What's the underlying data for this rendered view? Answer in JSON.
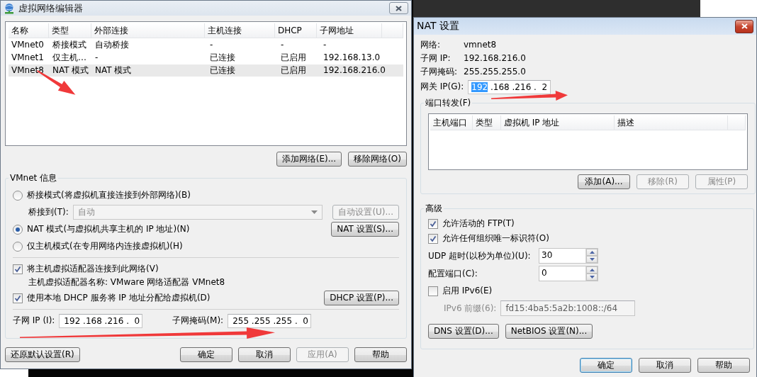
{
  "network_editor": {
    "title": "虚拟网络编辑器",
    "table": {
      "columns": [
        "名称",
        "类型",
        "外部连接",
        "主机连接",
        "DHCP",
        "子网地址"
      ],
      "rows": [
        {
          "cells": [
            "VMnet0",
            "桥接模式",
            "自动桥接",
            "-",
            "-",
            "-"
          ],
          "selected": false
        },
        {
          "cells": [
            "VMnet1",
            "仅主机…",
            "-",
            "已连接",
            "已启用",
            "192.168.13.0"
          ],
          "selected": false
        },
        {
          "cells": [
            "VMnet8",
            "NAT 模式",
            "NAT 模式",
            "已连接",
            "已启用",
            "192.168.216.0"
          ],
          "selected": true
        }
      ]
    },
    "table_buttons": [
      {
        "label": "添加网络(E)...",
        "disabled": false
      },
      {
        "label": "移除网络(O)",
        "disabled": false
      }
    ],
    "vmnet_info": {
      "title": "VMnet 信息",
      "modes": [
        {
          "label": "桥接模式(将虚拟机直接连接到外部网络)(B)",
          "selected": false
        },
        {
          "label": "NAT 模式(与虚拟机共享主机的 IP 地址)(N)",
          "selected": true
        },
        {
          "label": "仅主机模式(在专用网络内连接虚拟机)(H)",
          "selected": false
        }
      ],
      "bridge_to": {
        "label": "桥接到(T):",
        "value": "自动",
        "disabled": true
      },
      "auto_settings_button": {
        "label": "自动设置(U)...",
        "disabled": true
      },
      "nat_settings_button": {
        "label": "NAT 设置(S)...",
        "disabled": false
      },
      "connect_adapter": {
        "label": "将主机虚拟适配器连接到此网络(V)",
        "checked": true
      },
      "adapter_name": "主机虚拟适配器名称: VMware 网络适配器 VMnet8",
      "use_dhcp": {
        "label": "使用本地 DHCP 服务将 IP 地址分配给虚拟机(D)",
        "checked": true
      },
      "dhcp_settings_button": {
        "label": "DHCP 设置(P)...",
        "disabled": false
      },
      "subnet_ip": {
        "label": "子网 IP (I):",
        "value": "192 .168 .216 .  0"
      },
      "subnet_mask": {
        "label": "子网掩码(M):",
        "value": "255 .255 .255 .  0"
      }
    },
    "buttons": [
      {
        "label": "还原默认设置(R)",
        "disabled": false
      },
      {
        "label": "确定",
        "disabled": false
      },
      {
        "label": "取消",
        "disabled": false
      },
      {
        "label": "应用(A)",
        "disabled": true
      },
      {
        "label": "帮助",
        "disabled": false
      }
    ]
  },
  "nat_settings": {
    "title": "NAT 设置",
    "info": [
      {
        "label": "网络:",
        "value": "vmnet8"
      },
      {
        "label": "子网 IP:",
        "value": "192.168.216.0"
      },
      {
        "label": "子网掩码:",
        "value": "255.255.255.0"
      }
    ],
    "gateway": {
      "label": "网关 IP(G):",
      "parts": [
        {
          "text": "192",
          "selected": true
        },
        {
          "text": " .168 .216 .  2",
          "selected": false
        }
      ]
    },
    "port_forwarding": {
      "title": "端口转发(F)",
      "columns": [
        "主机端口",
        "类型",
        "虚拟机 IP 地址",
        "描述"
      ],
      "buttons": [
        {
          "label": "添加(A)...",
          "disabled": false
        },
        {
          "label": "移除(R)",
          "disabled": true
        },
        {
          "label": "属性(P)",
          "disabled": true
        }
      ]
    },
    "advanced": {
      "title": "高级",
      "allow_ftp": {
        "label": "允许活动的 FTP(T)",
        "checked": true
      },
      "allow_org_id": {
        "label": "允许任何组织唯一标识符(O)",
        "checked": true
      },
      "udp_timeout": {
        "label": "UDP 超时(以秒为单位)(U):",
        "value": "30"
      },
      "config_port": {
        "label": "配置端口(C):",
        "value": "0"
      },
      "enable_ipv6": {
        "label": "启用 IPv6(E)",
        "checked": false
      },
      "ipv6_prefix": {
        "label": "IPv6 前缀(6):",
        "value": "fd15:4ba5:5a2b:1008::/64",
        "disabled": true
      },
      "buttons": [
        {
          "label": "DNS 设置(D)...",
          "disabled": false
        },
        {
          "label": "NetBIOS 设置(N)...",
          "disabled": false
        }
      ]
    },
    "buttons": [
      {
        "label": "确定",
        "disabled": false,
        "default": true
      },
      {
        "label": "取消",
        "disabled": false,
        "default": false
      },
      {
        "label": "帮助",
        "disabled": false,
        "default": false
      }
    ]
  }
}
